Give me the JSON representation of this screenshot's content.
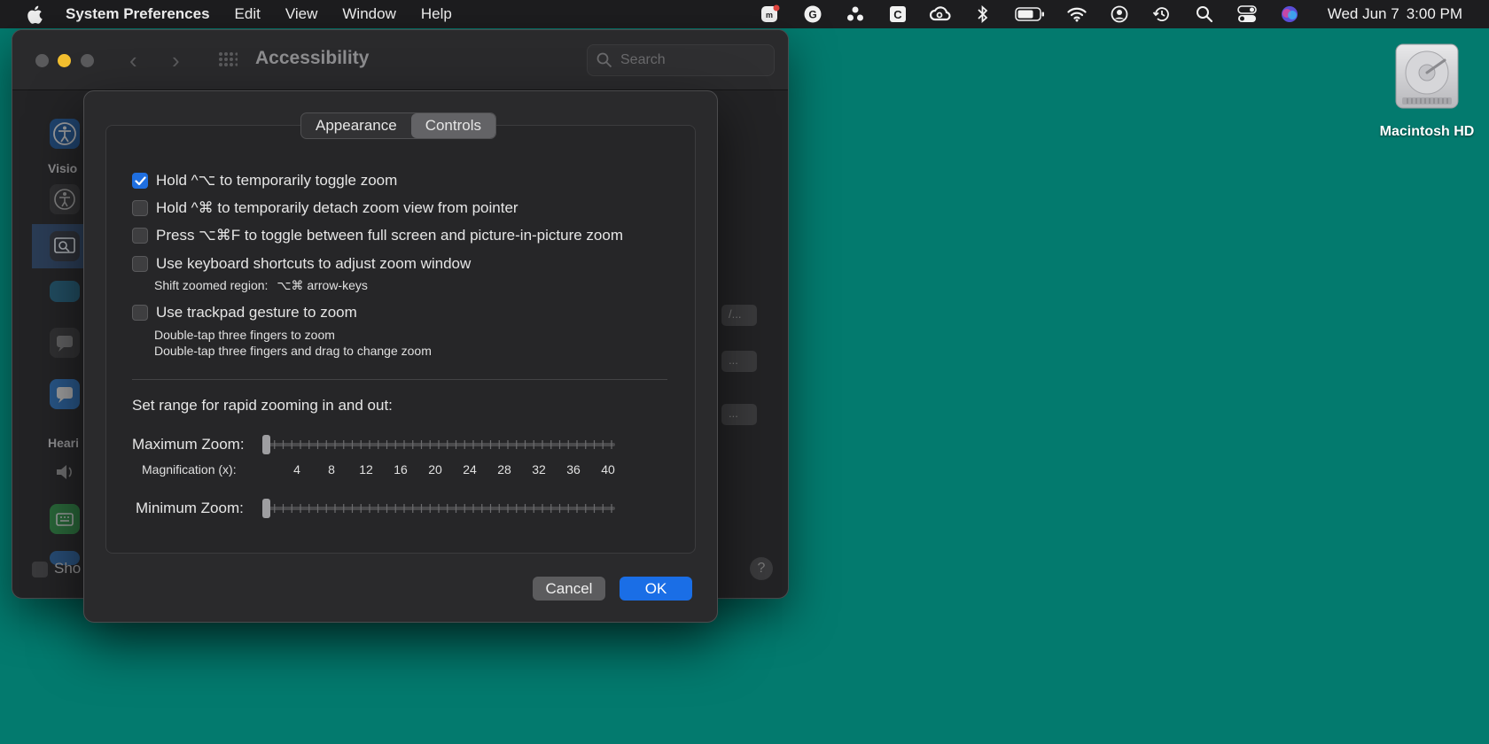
{
  "menubar": {
    "app_name": "System Preferences",
    "items": [
      "Edit",
      "View",
      "Window",
      "Help"
    ],
    "status_icons": [
      "mosaic-icon",
      "grammarly-icon",
      "dots-icon",
      "clipboard-icon",
      "creative-cloud-icon",
      "bluetooth-icon",
      "battery-icon",
      "wifi-icon",
      "user-icon",
      "time-machine-icon",
      "spotlight-icon",
      "control-center-icon",
      "siri-icon"
    ],
    "date": "Wed Jun 7",
    "time": "3:00 PM"
  },
  "background_window": {
    "title": "Accessibility",
    "search_placeholder": "Search",
    "sidebar_labels": [
      "Visio",
      "Heari"
    ],
    "show_label": "Sho",
    "ghost_buttons": [
      "/...",
      "...",
      "..."
    ],
    "help": "?"
  },
  "dialog": {
    "tabs": [
      "Appearance",
      "Controls"
    ],
    "active_tab": "Controls",
    "options": [
      {
        "label": "Hold ^⌥ to temporarily toggle zoom",
        "checked": true
      },
      {
        "label": "Hold ^⌘ to temporarily detach zoom view from pointer",
        "checked": false
      },
      {
        "label": "Press ⌥⌘F to toggle between full screen and picture-in-picture zoom",
        "checked": false
      },
      {
        "label": "Use keyboard shortcuts to adjust zoom window",
        "checked": false
      },
      {
        "label": "Use trackpad gesture to zoom",
        "checked": false
      }
    ],
    "shift_region_label": "Shift zoomed region:",
    "shift_region_keys": "⌥⌘ arrow-keys",
    "trackpad_hint_1": "Double-tap three fingers to zoom",
    "trackpad_hint_2": "Double-tap three fingers and drag to change zoom",
    "range_title": "Set range for rapid zooming in and out:",
    "max_zoom_label": "Maximum Zoom:",
    "min_zoom_label": "Minimum Zoom:",
    "magnification_label": "Magnification (x):",
    "tick_values": [
      "4",
      "8",
      "12",
      "16",
      "20",
      "24",
      "28",
      "32",
      "36",
      "40"
    ],
    "max_zoom_value": 0,
    "min_zoom_value": 0,
    "cancel_label": "Cancel",
    "ok_label": "OK"
  },
  "desktop": {
    "disk_label": "Macintosh HD"
  },
  "colors": {
    "desktop": "#037a6e",
    "accent": "#1a6ee6",
    "traffic_min": "#f3bf2f"
  }
}
